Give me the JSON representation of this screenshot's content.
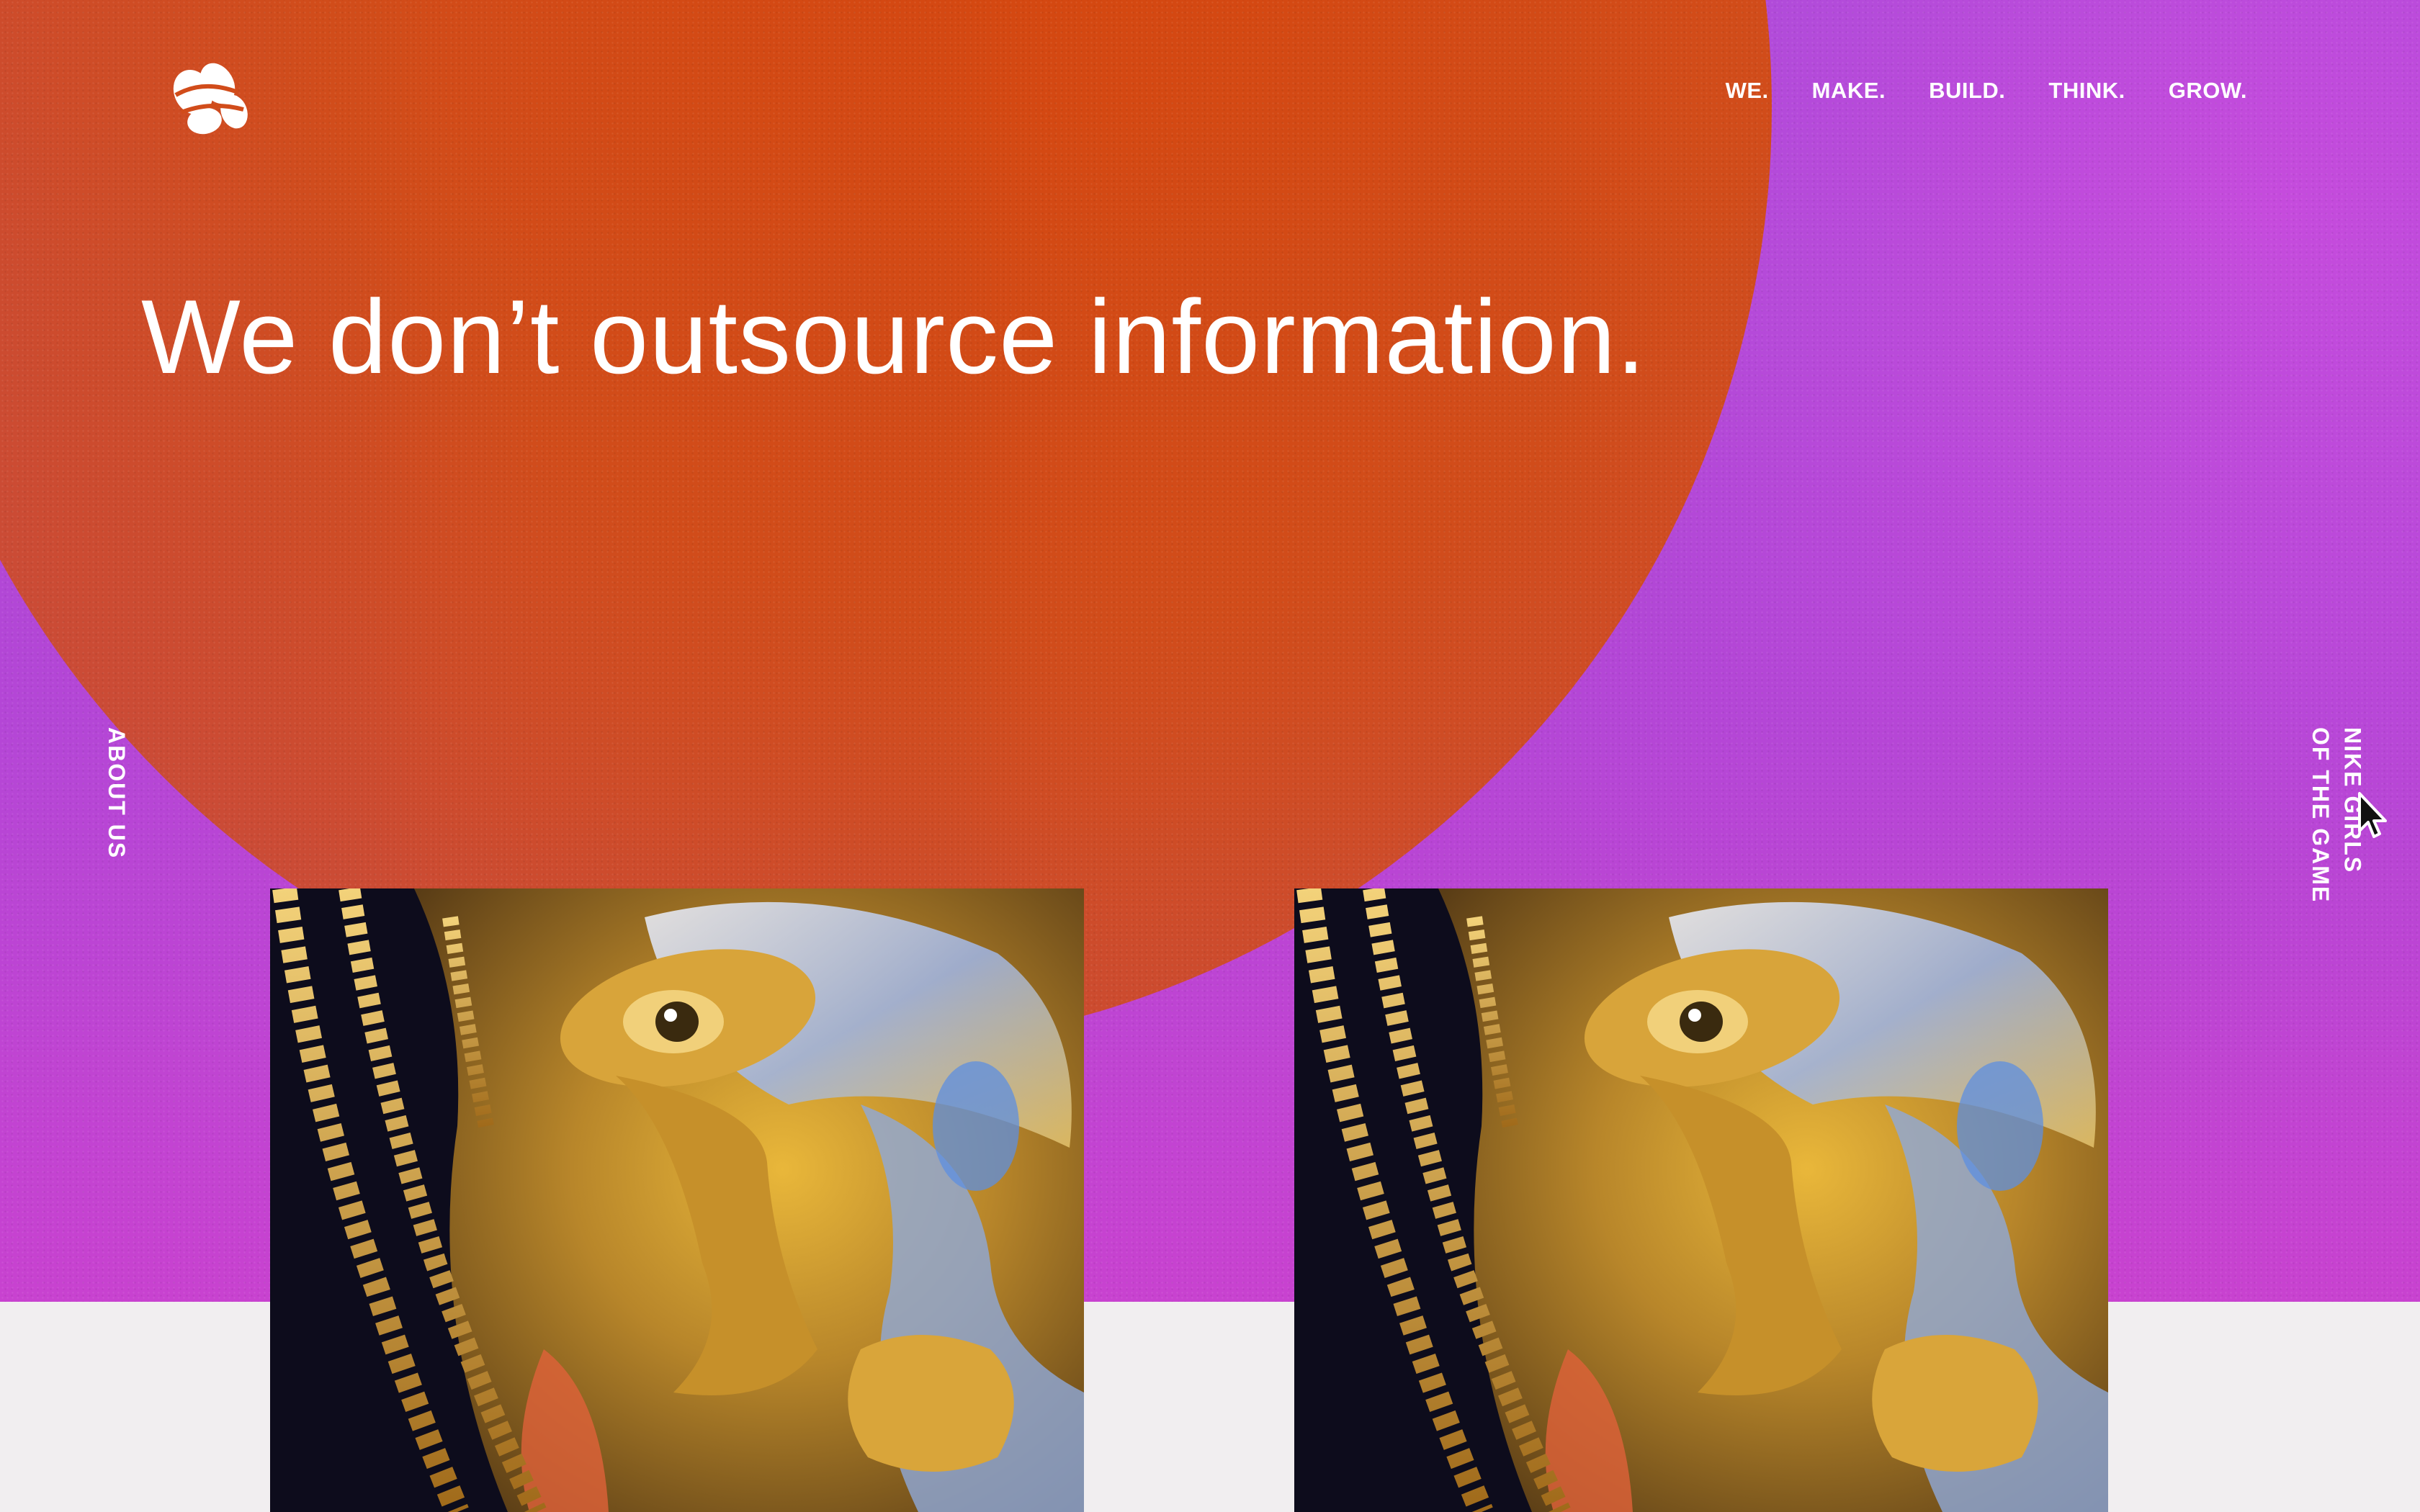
{
  "brand": {
    "logo_icon": "pebbles-logo-icon"
  },
  "nav": {
    "items": [
      {
        "label": "WE."
      },
      {
        "label": "MAKE."
      },
      {
        "label": "BUILD."
      },
      {
        "label": "THINK."
      },
      {
        "label": "GROW."
      }
    ]
  },
  "hero": {
    "headline": "We don’t outsource information."
  },
  "side": {
    "left_label": "ABOUT US",
    "right_label_line1": "NIKE GIRLS",
    "right_label_line2": "OF THE GAME"
  },
  "colors": {
    "orange": "#d14c1a",
    "purple": "#b446d6",
    "magenta": "#c842d0",
    "page_bg": "#f1eef0",
    "gold": "#d9a224"
  },
  "cards": [
    {
      "image": "golden-face-artwork"
    },
    {
      "image": "golden-face-artwork"
    }
  ]
}
